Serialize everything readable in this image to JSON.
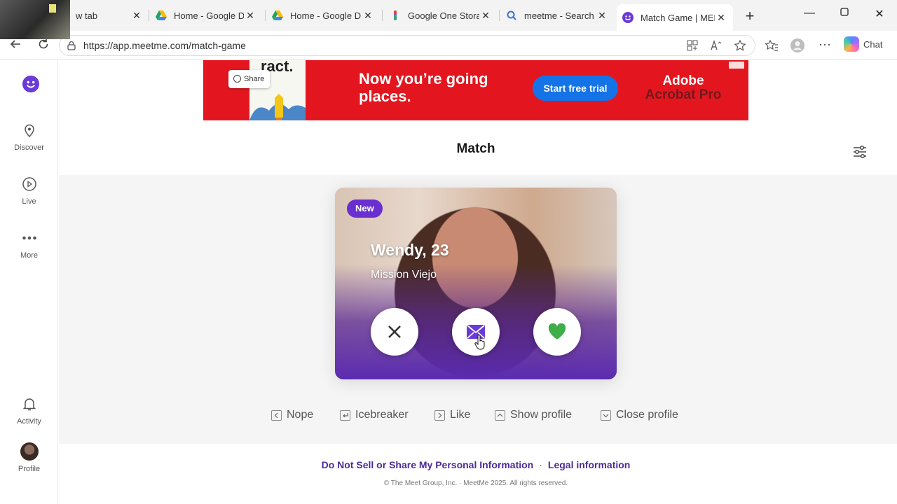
{
  "browser": {
    "tabs": [
      {
        "title": "w tab",
        "favicon": "new-tab"
      },
      {
        "title": "Home - Google Dr",
        "favicon": "google-drive"
      },
      {
        "title": "Home - Google Dr",
        "favicon": "google-drive"
      },
      {
        "title": "Google One Storag",
        "favicon": "google-one"
      },
      {
        "title": "meetme - Search",
        "favicon": "search"
      },
      {
        "title": "Match Game | MEE",
        "favicon": "meetme",
        "active": true
      }
    ],
    "url": "https://app.meetme.com/match-game",
    "chat_label": "Chat"
  },
  "sidebar": {
    "items": [
      {
        "label": "Discover",
        "icon": "location-pin-icon"
      },
      {
        "label": "Live",
        "icon": "play-icon"
      },
      {
        "label": "More",
        "icon": "more-dots-icon"
      },
      {
        "label": "Activity",
        "icon": "bell-icon"
      },
      {
        "label": "Profile",
        "icon": "avatar"
      }
    ]
  },
  "ad": {
    "doc_title": "ract.",
    "share_label": "Share",
    "headline": "Now you’re going places.",
    "cta": "Start free trial",
    "brand_line1": "Adobe",
    "brand_line2": "Acrobat Pro"
  },
  "match": {
    "title": "Match",
    "card": {
      "badge": "New",
      "name": "Wendy, 23",
      "location": "Mission Viejo"
    }
  },
  "shortcuts": [
    {
      "label": "Nope",
      "key": "left"
    },
    {
      "label": "Icebreaker",
      "key": "enter"
    },
    {
      "label": "Like",
      "key": "right"
    },
    {
      "label": "Show profile",
      "key": "up"
    },
    {
      "label": "Close profile",
      "key": "down"
    }
  ],
  "footer": {
    "link1": "Do Not Sell or Share My Personal Information",
    "separator": "·",
    "link2": "Legal information",
    "copyright": "© The Meet Group, Inc. · MeetMe 2025. All rights reserved."
  },
  "colors": {
    "brand_purple": "#6a3bd6",
    "ad_red": "#e3161f",
    "like_green": "#3fae49"
  }
}
